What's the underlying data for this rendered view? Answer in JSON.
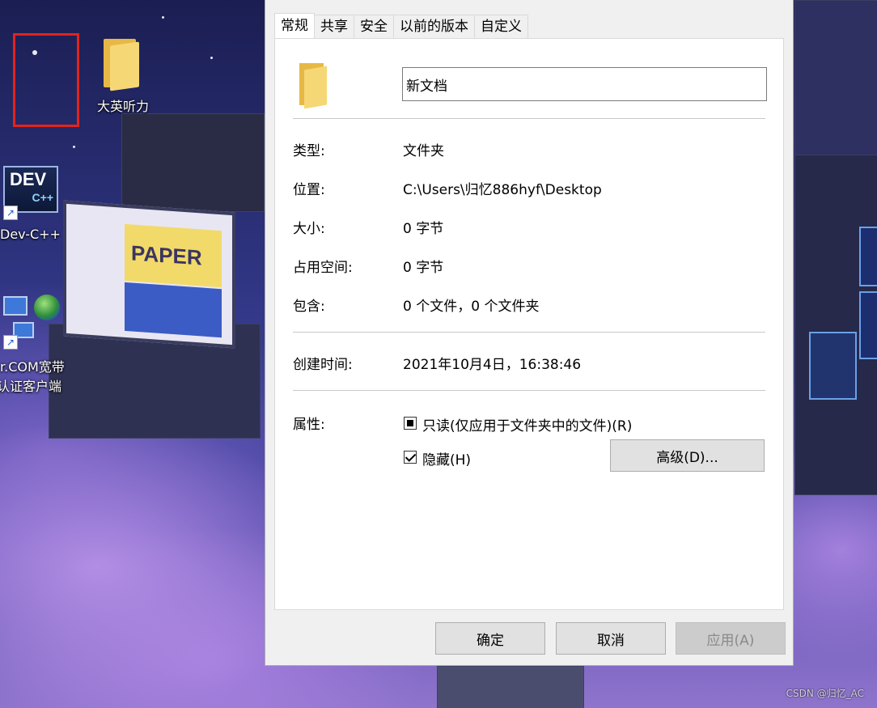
{
  "desktop": {
    "icons": [
      {
        "label": "大英听力"
      },
      {
        "label": "Dev-C++",
        "badge": "DEV",
        "badge_sub": "C++"
      },
      {
        "label_line1": "r.COM宽带",
        "label_line2": "认证客户端"
      }
    ],
    "billboard_text": "PAPER",
    "watermark": "CSDN @归忆_AC"
  },
  "dialog": {
    "tabs": [
      {
        "label": "常规",
        "active": true
      },
      {
        "label": "共享"
      },
      {
        "label": "安全"
      },
      {
        "label": "以前的版本"
      },
      {
        "label": "自定义"
      }
    ],
    "name_value": "新文档",
    "rows": {
      "type": {
        "label": "类型:",
        "value": "文件夹"
      },
      "location": {
        "label": "位置:",
        "value": "C:\\Users\\归忆886hyf\\Desktop"
      },
      "size": {
        "label": "大小:",
        "value": "0 字节"
      },
      "size_on_disk": {
        "label": "占用空间:",
        "value": "0 字节"
      },
      "contains": {
        "label": "包含:",
        "value": "0 个文件，0 个文件夹"
      },
      "created": {
        "label": "创建时间:",
        "value": "2021年10月4日，16:38:46"
      }
    },
    "attributes": {
      "label": "属性:",
      "readonly_label": "只读(仅应用于文件夹中的文件)(R)",
      "readonly_state": "indeterminate",
      "hidden_label": "隐藏(H)",
      "hidden_state": "checked",
      "advanced_label": "高级(D)..."
    },
    "buttons": {
      "ok": "确定",
      "cancel": "取消",
      "apply": "应用(A)"
    }
  }
}
